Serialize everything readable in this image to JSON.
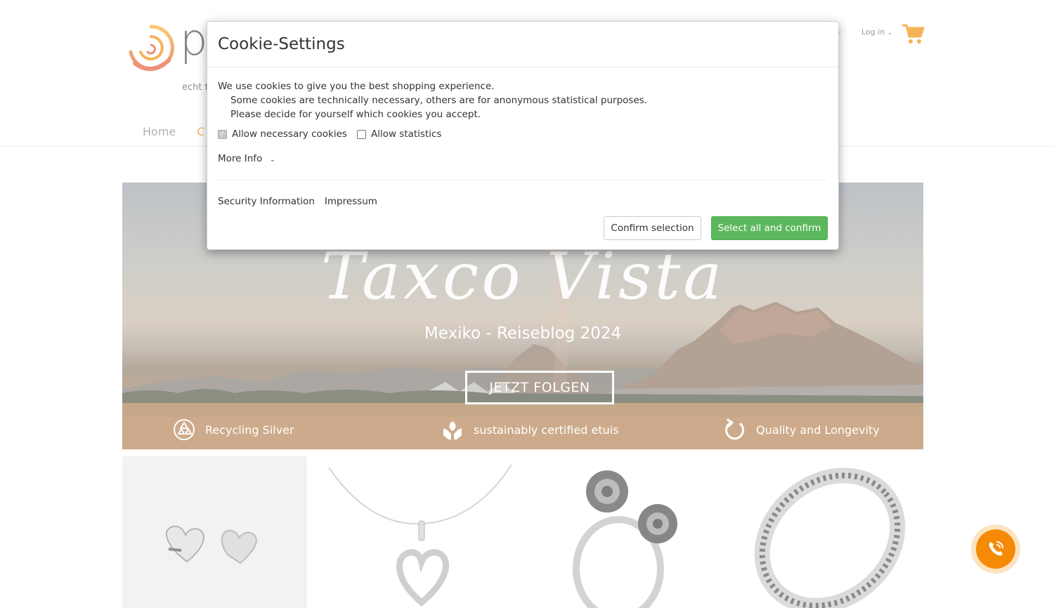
{
  "header": {
    "logo_text": "pa",
    "tagline_prefix": "echt",
    "tagline_bold": "f",
    "login_label": "Log in",
    "login_caret": "⌄",
    "account_caret": "⌄",
    "cart_icon": "shopping-cart-icon",
    "accent_color": "#f08a00"
  },
  "nav": {
    "items": [
      {
        "label": "Home"
      },
      {
        "label": "C"
      }
    ]
  },
  "hero": {
    "script_title": "Taxco Vista",
    "subtitle": "Mexiko - Reiseblog 2024",
    "button_label": "JETZT FOLGEN",
    "features": [
      {
        "icon": "recycle-icon",
        "label": "Recycling Silver"
      },
      {
        "icon": "hands-leaf-icon",
        "label": "sustainably certified etuis"
      },
      {
        "icon": "refresh-circle-icon",
        "label": "Quality and Longevity"
      }
    ]
  },
  "products": [
    {
      "icon": "heart-earrings-image"
    },
    {
      "icon": "heart-pendant-necklace-image"
    },
    {
      "icon": "rose-ring-image"
    },
    {
      "icon": "marcasite-ring-image"
    }
  ],
  "cookie_dialog": {
    "title": "Cookie-Settings",
    "line1": "We use cookies to give you the best shopping experience.",
    "line2": "Some cookies are technically necessary, others are for anonymous statistical purposes.",
    "line3": "Please decide for yourself which cookies you accept.",
    "necessary_label": "Allow necessary cookies",
    "necessary_checked": true,
    "statistics_label": "Allow statistics",
    "statistics_checked": false,
    "more_info_label": "More Info",
    "security_link": "Security Information",
    "impressum_link": "Impressum",
    "confirm_selection_label": "Confirm selection",
    "select_all_label": "Select all and confirm",
    "primary_color": "#5cb85c"
  },
  "call_button": {
    "icon": "phone-icon",
    "color": "#f58a07"
  }
}
